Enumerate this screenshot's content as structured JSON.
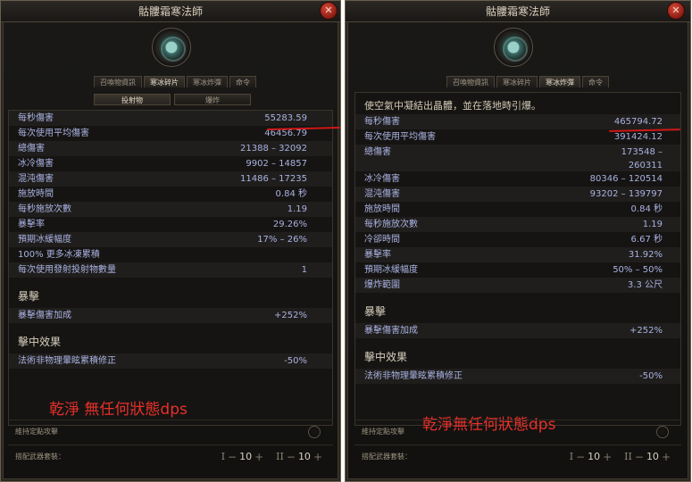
{
  "window_title": "骷髏霜寒法師",
  "close_symbol": "✕",
  "left": {
    "tabs": [
      "召喚物資訊",
      "寒冰碎片",
      "寒冰炸彈",
      "命令"
    ],
    "active_tab": 1,
    "subtabs": [
      "投射物",
      "爆炸"
    ],
    "stats": [
      {
        "label": "每秒傷害",
        "value": "55283.59"
      },
      {
        "label": "每次使用平均傷害",
        "value": "46456.79"
      },
      {
        "label": "總傷害",
        "value": "21388 – 32092"
      },
      {
        "label": "冰冷傷害",
        "value": "9902 – 14857"
      },
      {
        "label": "混沌傷害",
        "value": "11486 – 17235"
      },
      {
        "label": "施放時間",
        "value": "0.84 秒"
      },
      {
        "label": "每秒施放次數",
        "value": "1.19"
      },
      {
        "label": "暴擊率",
        "value": "29.26%"
      },
      {
        "label": "預期冰緩幅度",
        "value": "17% – 26%"
      },
      {
        "label": "100% 更多冰凍累積",
        "value": ""
      },
      {
        "label": "每次使用發射投射物數量",
        "value": "1"
      }
    ],
    "crit_heading": "暴擊",
    "crit_stats": [
      {
        "label": "暴擊傷害加成",
        "value": "+252%"
      }
    ],
    "hit_heading": "擊中效果",
    "hit_stats": [
      {
        "label": "法術非物理暈眩累積修正",
        "value": "-50%"
      }
    ],
    "annotation": "乾淨 無任何狀態dps",
    "hold_attack_label": "維持定點攻擊",
    "weapon_set_label": "搭配武器套裝：",
    "weapon_set_1": {
      "numeral": "I",
      "value": "10"
    },
    "weapon_set_2": {
      "numeral": "II",
      "value": "10"
    }
  },
  "right": {
    "tabs": [
      "召喚物資訊",
      "寒冰碎片",
      "寒冰炸彈",
      "命令"
    ],
    "active_tab": 2,
    "description": "使空氣中凝結出晶體，並在落地時引爆。",
    "stats": [
      {
        "label": "每秒傷害",
        "value": "465794.72"
      },
      {
        "label": "每次使用平均傷害",
        "value": "391424.12"
      },
      {
        "label": "總傷害",
        "value": "173548 –",
        "value2": "260311"
      },
      {
        "label": "冰冷傷害",
        "value": "80346 – 120514"
      },
      {
        "label": "混沌傷害",
        "value": "93202 – 139797"
      },
      {
        "label": "施放時間",
        "value": "0.84 秒"
      },
      {
        "label": "每秒施放次數",
        "value": "1.19"
      },
      {
        "label": "冷卻時間",
        "value": "6.67 秒"
      },
      {
        "label": "暴擊率",
        "value": "31.92%"
      },
      {
        "label": "預期冰緩幅度",
        "value": "50% – 50%"
      },
      {
        "label": "爆炸範圍",
        "value": "3.3 公尺"
      }
    ],
    "crit_heading": "暴擊",
    "crit_stats": [
      {
        "label": "暴擊傷害加成",
        "value": "+252%"
      }
    ],
    "hit_heading": "擊中效果",
    "hit_stats": [
      {
        "label": "法術非物理暈眩累積修正",
        "value": "-50%"
      }
    ],
    "annotation": "乾淨無任何狀態dps",
    "hold_attack_label": "維持定點攻擊",
    "weapon_set_label": "搭配武器套裝：",
    "weapon_set_1": {
      "numeral": "I",
      "value": "10"
    },
    "weapon_set_2": {
      "numeral": "II",
      "value": "10"
    }
  },
  "colors": {
    "annotation_red": "#e8302a",
    "stat_text": "#aab2e2",
    "panel_bg": "#141312"
  }
}
